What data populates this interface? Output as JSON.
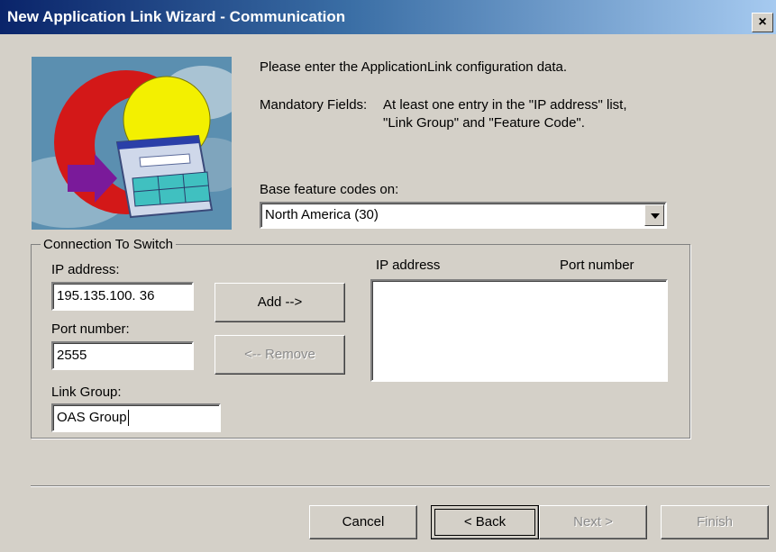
{
  "window": {
    "title": "New Application Link Wizard - Communication",
    "close_glyph": "×"
  },
  "intro": {
    "line1": "Please enter the ApplicationLink configuration data.",
    "mandatory_label": "Mandatory Fields:",
    "mandatory_text1": "At least one entry in the \"IP address\" list,",
    "mandatory_text2": "\"Link Group\" and \"Feature Code\"."
  },
  "feature": {
    "label": "Base feature codes on:",
    "selected": "North America (30)"
  },
  "connection": {
    "group_label": "Connection To Switch",
    "ip_label": "IP address:",
    "ip_value": "195.135.100. 36",
    "port_label": "Port number:",
    "port_value": "2555",
    "link_group_label": "Link Group:",
    "link_group_value": "OAS Group",
    "add_button": "Add -->",
    "remove_button": "<-- Remove",
    "list_header_ip": "IP address",
    "list_header_port": "Port number"
  },
  "footer": {
    "cancel": "Cancel",
    "back": "< Back",
    "next": "Next >",
    "finish": "Finish"
  },
  "icons": {
    "illustration": "wizard-illustration-icon",
    "close": "close-icon",
    "dropdown": "chevron-down-icon"
  }
}
